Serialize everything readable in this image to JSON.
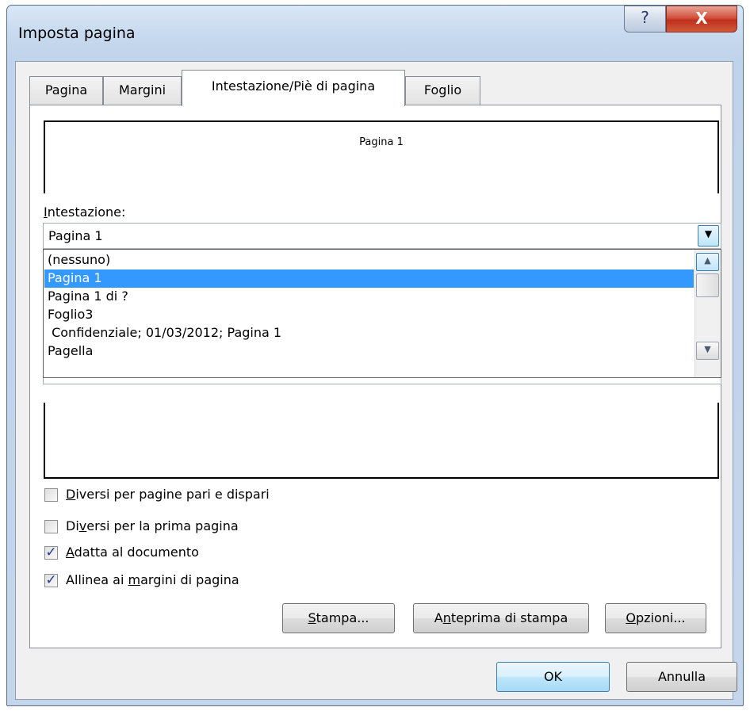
{
  "window": {
    "title": "Imposta pagina",
    "help_glyph": "?",
    "close_glyph": "X"
  },
  "tabs": [
    {
      "label": "Pagina",
      "active": false
    },
    {
      "label": "Margini",
      "active": false
    },
    {
      "label": "Intestazione/Piè di pagina",
      "active": true
    },
    {
      "label": "Foglio",
      "active": false
    }
  ],
  "header_preview": {
    "text": "Pagina 1"
  },
  "header_field": {
    "label": "Intestazione:",
    "label_mnemonic": "I",
    "label_rest": "ntestazione:",
    "value": "Pagina 1"
  },
  "dropdown": {
    "options": [
      "(nessuno)",
      "Pagina 1",
      "Pagina 1 di ?",
      "Foglio3",
      " Confidenziale; 01/03/2012; Pagina 1",
      "Pagella"
    ],
    "selected_index": 1
  },
  "checkboxes": [
    {
      "pre": "",
      "mnemonic": "D",
      "post": "iversi per pagine pari e dispari",
      "checked": false
    },
    {
      "pre": "Di",
      "mnemonic": "v",
      "post": "ersi per la prima pagina",
      "checked": false
    },
    {
      "pre": "",
      "mnemonic": "A",
      "post": "datta al documento",
      "checked": true
    },
    {
      "pre": "Allinea ai ",
      "mnemonic": "m",
      "post": "argini di pagina",
      "checked": true
    }
  ],
  "buttons": {
    "print": {
      "pre": "",
      "mnemonic": "S",
      "post": "tampa..."
    },
    "print_preview": {
      "pre": "A",
      "mnemonic": "n",
      "post": "teprima di stampa"
    },
    "options": {
      "pre": "",
      "mnemonic": "O",
      "post": "pzioni..."
    },
    "ok": "OK",
    "cancel": "Annulla"
  },
  "icons": {
    "help": "help-icon",
    "close": "close-icon",
    "dropdown": "chevron-down-icon",
    "scroll_up": "arrow-up-icon",
    "scroll_down": "arrow-down-icon",
    "check": "checkmark-icon"
  }
}
